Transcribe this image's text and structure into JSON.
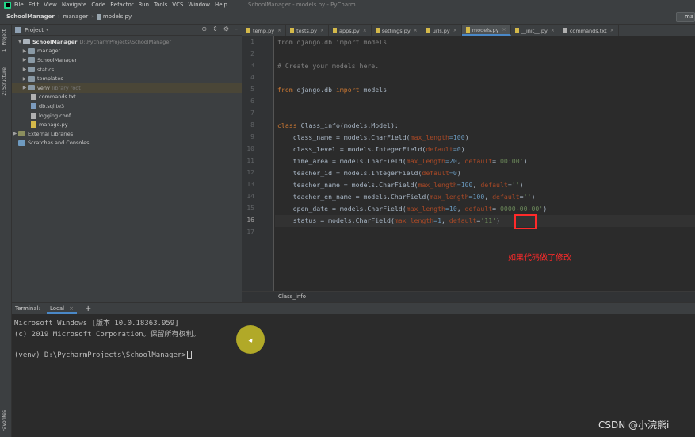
{
  "menubar": {
    "items": [
      "File",
      "Edit",
      "View",
      "Navigate",
      "Code",
      "Refactor",
      "Run",
      "Tools",
      "VCS",
      "Window",
      "Help"
    ],
    "window_title": "SchoolManager - models.py - PyCharm"
  },
  "navbar": {
    "crumbs": [
      "SchoolManager",
      "manager",
      "models.py"
    ],
    "run_label": "ma"
  },
  "left_strip": {
    "tabs": [
      "1: Project",
      "2: Structure",
      "Favorites"
    ]
  },
  "project_panel": {
    "header_label": "Project",
    "tree": [
      {
        "name": "SchoolManager",
        "extra": "D:\\PycharmProjects\\SchoolManager",
        "type": "root"
      },
      {
        "name": "manager",
        "extra": "",
        "type": "folder"
      },
      {
        "name": "SchoolManager",
        "extra": "",
        "type": "folder"
      },
      {
        "name": "statics",
        "extra": "",
        "type": "folder"
      },
      {
        "name": "templates",
        "extra": "",
        "type": "folder"
      },
      {
        "name": "venv",
        "extra": "library root",
        "type": "folder"
      },
      {
        "name": "commands.txt",
        "extra": "",
        "type": "file"
      },
      {
        "name": "db.sqlite3",
        "extra": "",
        "type": "file"
      },
      {
        "name": "logging.conf",
        "extra": "",
        "type": "file"
      },
      {
        "name": "manage.py",
        "extra": "",
        "type": "file"
      },
      {
        "name": "External Libraries",
        "extra": "",
        "type": "lib"
      },
      {
        "name": "Scratches and Consoles",
        "extra": "",
        "type": "lib"
      }
    ]
  },
  "editor": {
    "tabs": [
      "temp.py",
      "tests.py",
      "apps.py",
      "settings.py",
      "urls.py",
      "models.py",
      "__init__.py",
      "commands.txt"
    ],
    "active_tab": "models.py",
    "line_numbers": [
      "1",
      "2",
      "3",
      "4",
      "5",
      "6",
      "7",
      "8",
      "9",
      "10",
      "11",
      "12",
      "13",
      "14",
      "15",
      "16",
      "17"
    ],
    "current_line": "16",
    "code": {
      "l1": "from django.db import models",
      "l3": "# Create your models here.",
      "l5_kw1": "from",
      "l5_mid": " django.db ",
      "l5_kw2": "import",
      "l5_end": " models",
      "l8_kw": "class",
      "l8_rest": " Class_info(models.Model):",
      "l9_a": "    class_name = models.CharField(",
      "l9_p": "max_length",
      "l9_n": "=100",
      "l9_c": ")",
      "l10_a": "    class_level = models.IntegerField(",
      "l10_p": "default",
      "l10_n": "=0",
      "l10_c": ")",
      "l11_a": "    time_area = models.CharField(",
      "l11_p1": "max_length",
      "l11_n1": "=20",
      "l11_s1": ", ",
      "l11_p2": "default",
      "l11_eq": "=",
      "l11_str": "'00:00'",
      "l11_c": ")",
      "l12_a": "    teacher_id = models.IntegerField(",
      "l12_p": "default",
      "l12_n": "=0",
      "l12_c": ")",
      "l13_a": "    teacher_name = models.CharField(",
      "l13_p1": "max_length",
      "l13_n1": "=100",
      "l13_s1": ", ",
      "l13_p2": "default",
      "l13_eq": "=",
      "l13_str": "''",
      "l13_c": ")",
      "l14_a": "    teacher_en_name = models.CharField(",
      "l14_p1": "max_length",
      "l14_n1": "=100",
      "l14_s1": ", ",
      "l14_p2": "default",
      "l14_eq": "=",
      "l14_str": "''",
      "l14_c": ")",
      "l15_a": "    open_date = models.CharField(",
      "l15_p1": "max_length",
      "l15_n1": "=10",
      "l15_s1": ", ",
      "l15_p2": "default",
      "l15_eq": "=",
      "l15_str": "'0000-00-00'",
      "l15_c": ")",
      "l16_a": "    status = models.CharField(",
      "l16_p1": "max_length",
      "l16_n1": "=1",
      "l16_s1": ", ",
      "l16_p2": "default",
      "l16_eq": "=",
      "l16_str": "'11'",
      "l16_c": ")"
    },
    "annotation": "如果代码做了修改",
    "breadcrumb": "Class_info"
  },
  "terminal": {
    "title": "Terminal:",
    "tab": "Local",
    "lines": [
      "Microsoft Windows [版本 10.0.18363.959]",
      "(c) 2019 Microsoft Corporation。保留所有权利。",
      "",
      "(venv) D:\\PycharmProjects\\SchoolManager>"
    ]
  },
  "watermark": "CSDN @小浣熊i",
  "colors": {
    "keyword": "#cc7832",
    "number": "#6897bb",
    "string": "#6a8759",
    "param": "#aa4926",
    "comment": "#808080",
    "annotation_red": "#ff2a2a"
  }
}
